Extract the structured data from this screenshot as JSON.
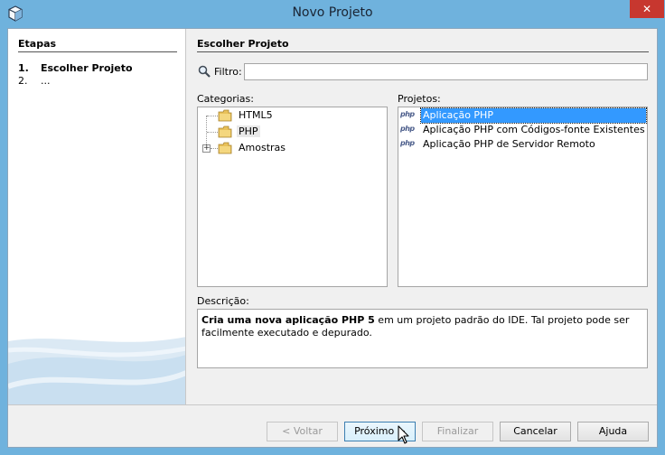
{
  "window": {
    "title": "Novo Projeto",
    "close_glyph": "✕"
  },
  "steps": {
    "title": "Etapas",
    "items": [
      {
        "num": "1.",
        "label": "Escolher Projeto"
      },
      {
        "num": "2.",
        "label": "..."
      }
    ]
  },
  "content": {
    "title": "Escolher Projeto",
    "filter_label": "Filtro:",
    "filter_value": "",
    "categories_label": "Categorias:",
    "projects_label": "Projetos:",
    "categories": [
      {
        "label": "HTML5",
        "selected": false,
        "expandable": false
      },
      {
        "label": "PHP",
        "selected": true,
        "expandable": false
      },
      {
        "label": "Amostras",
        "selected": false,
        "expandable": true
      }
    ],
    "projects": [
      {
        "icon": "php",
        "label": "Aplicação PHP",
        "selected": true
      },
      {
        "icon": "php",
        "label": "Aplicação PHP com Códigos-fonte Existentes",
        "selected": false
      },
      {
        "icon": "php",
        "label": "Aplicação PHP de Servidor Remoto",
        "selected": false
      }
    ],
    "description_label": "Descrição:",
    "description_bold": "Cria uma nova aplicação PHP 5",
    "description_rest": " em um projeto padrão do IDE. Tal projeto pode ser facilmente executado e depurado."
  },
  "buttons": {
    "back": "< Voltar",
    "next": "Próximo >",
    "finish": "Finalizar",
    "cancel": "Cancelar",
    "help": "Ajuda"
  },
  "icons": {
    "app": "netbeans-cube-icon",
    "filter": "magnifier-icon",
    "folder": "folder-icon",
    "php": "php-icon",
    "cursor": "mouse-pointer-icon"
  },
  "colors": {
    "titlebar": "#6fb2dd",
    "selection": "#3399ff",
    "close": "#c7372f"
  }
}
